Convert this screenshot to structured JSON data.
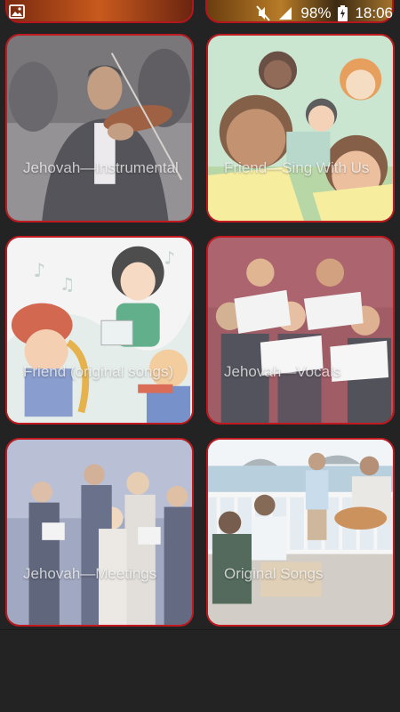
{
  "status_bar": {
    "battery": "98%",
    "time": "18:06",
    "icons": [
      "gallery-notification-icon",
      "mute-icon",
      "signal-icon",
      "battery-icon"
    ]
  },
  "tiles": [
    {
      "label": "Jehovah—Instrumental"
    },
    {
      "label": "Friend—Sing With Us"
    },
    {
      "label": "Friend (original songs)"
    },
    {
      "label": "Jehovah—Vocals"
    },
    {
      "label": "Jehovah—Meetings"
    },
    {
      "label": "Original Songs"
    }
  ],
  "colors": {
    "border_accent": "#c0191f",
    "background": "#232323"
  }
}
